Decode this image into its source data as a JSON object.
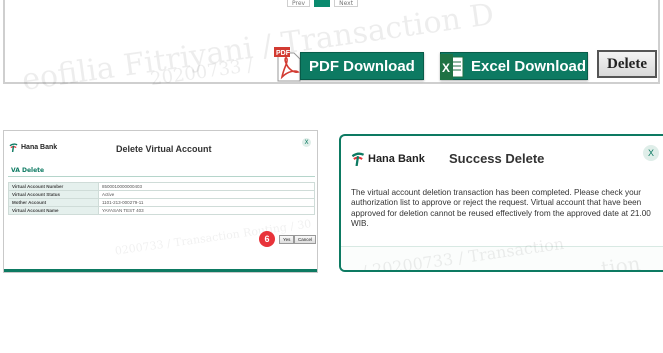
{
  "top": {
    "pager": {
      "prev": "Prev",
      "next": "Next"
    },
    "pdf_button": "PDF Download",
    "excel_button": "Excel Download",
    "delete_button": "Delete"
  },
  "left_dialog": {
    "brand": "Hana Bank",
    "title": "Delete Virtual Account",
    "close": "X",
    "section": "VA Delete",
    "rows": [
      {
        "label": "Virtual Account Number",
        "value": "8500010000000403"
      },
      {
        "label": "Virtual Account Status",
        "value": "Active"
      },
      {
        "label": "Mother Account",
        "value": "1101-213-000279-11"
      },
      {
        "label": "Virtual Account Name",
        "value": "YAYASAN TEST 403"
      }
    ],
    "step_number": "6",
    "yes_button": "Yes",
    "cancel_button": "Cancel"
  },
  "right_dialog": {
    "brand": "Hana Bank",
    "title": "Success Delete",
    "close": "X",
    "message": "The virtual account deletion transaction has been completed. Please check your authorization list to approve or reject the request. Virtual account that have been approved for deletion cannot be reused effectively from the approved date at 21.00 WIB."
  },
  "colors": {
    "brand_green": "#0d7a62",
    "step_red": "#e8333a"
  }
}
